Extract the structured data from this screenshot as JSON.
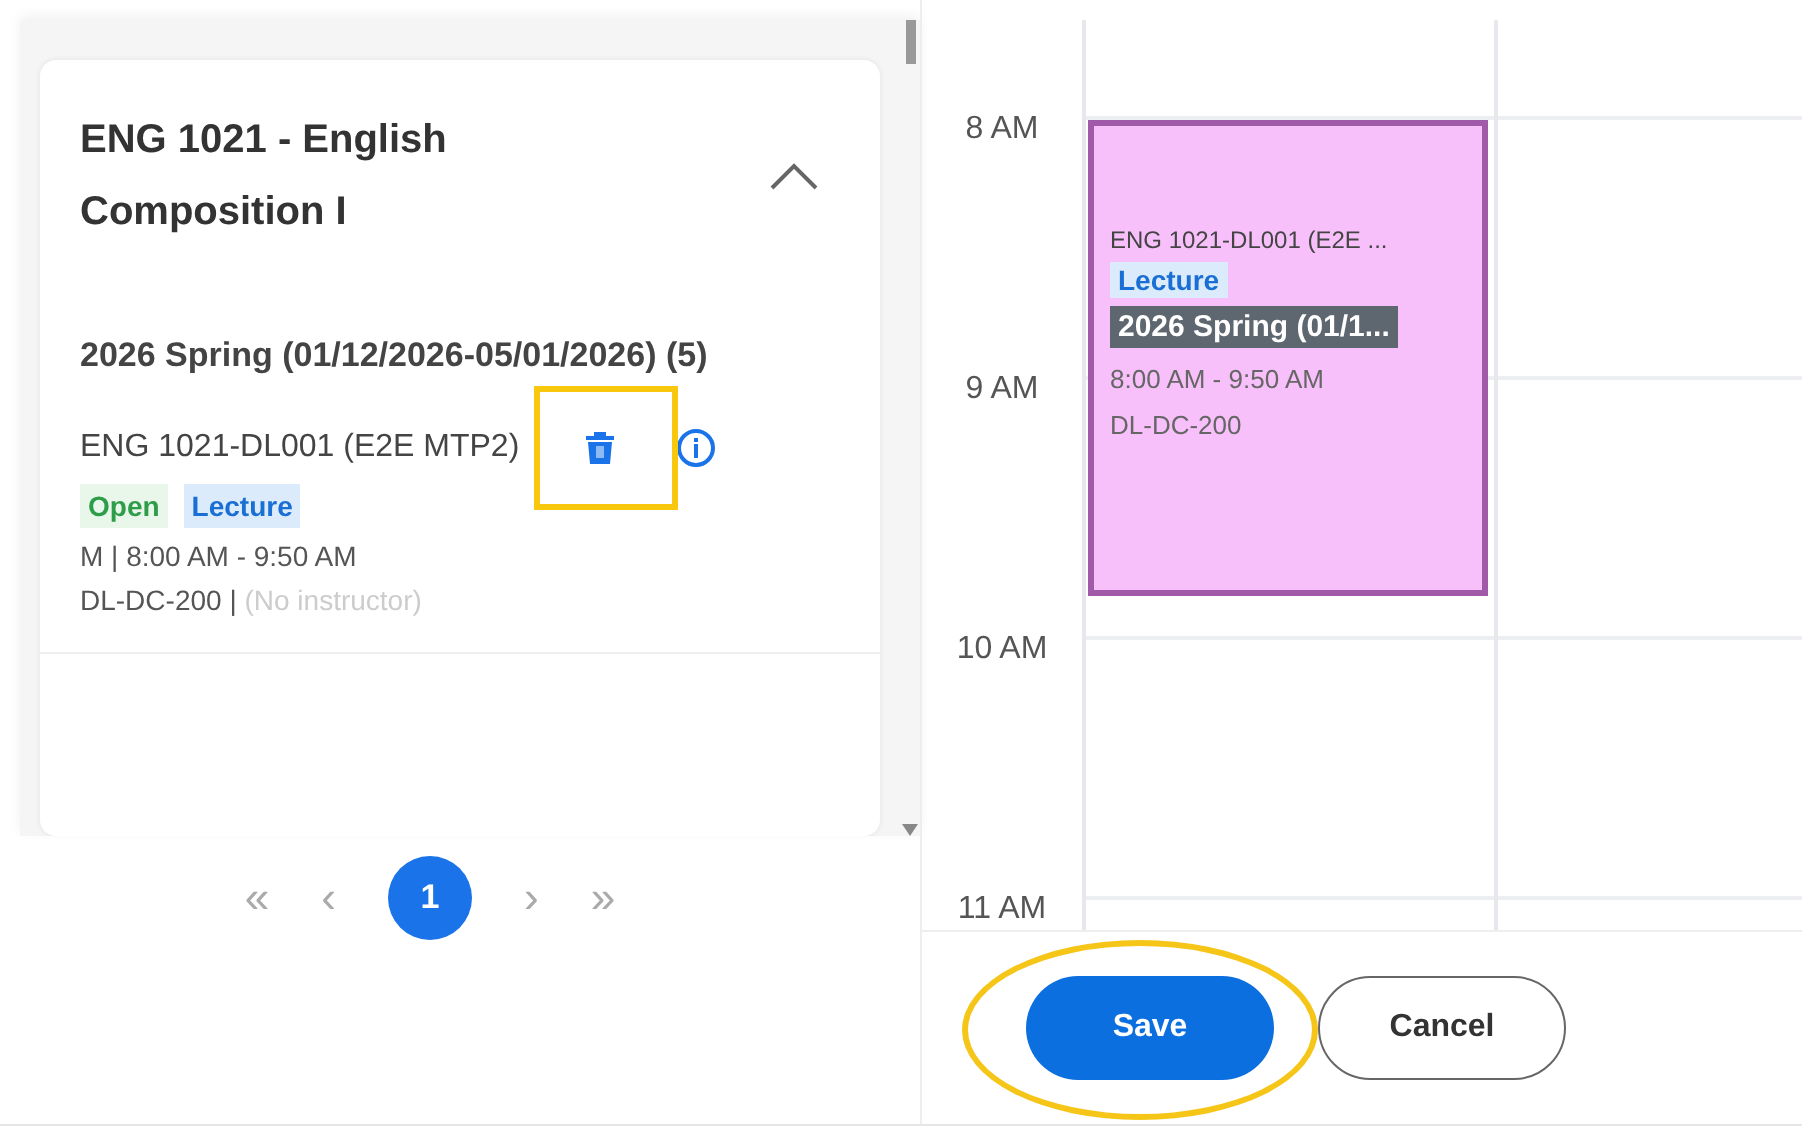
{
  "course": {
    "title": "ENG 1021 - English Composition I",
    "expanded": true,
    "term": "2026 Spring (01/12/2026-05/01/2026) (5)",
    "section": {
      "name": "ENG 1021-DL001 (E2E MTP2)",
      "tags": [
        {
          "label": "Open",
          "kind": "status"
        },
        {
          "label": "Lecture",
          "kind": "type"
        }
      ],
      "schedule": "M | 8:00 AM - 9:50 AM",
      "room": "DL-DC-200 |",
      "instructor": "(No instructor)",
      "highlighted": true
    }
  },
  "pagination": {
    "first": "«",
    "prev": "‹",
    "pages": [
      {
        "label": "1",
        "selected": true
      }
    ],
    "next": "›",
    "last": "»"
  },
  "calendar": {
    "times": [
      "8 AM",
      "9 AM",
      "10 AM",
      "11 AM"
    ],
    "event": {
      "title": "ENG 1021-DL001 (E2E ...",
      "tag": "Lecture",
      "term": "2026 Spring (01/1...",
      "time": "8:00 AM - 9:50 AM",
      "room": "DL-DC-200"
    }
  },
  "buttons": [
    {
      "label": "Save",
      "kind": "primary",
      "highlighted": true
    },
    {
      "label": "Cancel",
      "kind": "secondary",
      "highlighted": false
    }
  ]
}
